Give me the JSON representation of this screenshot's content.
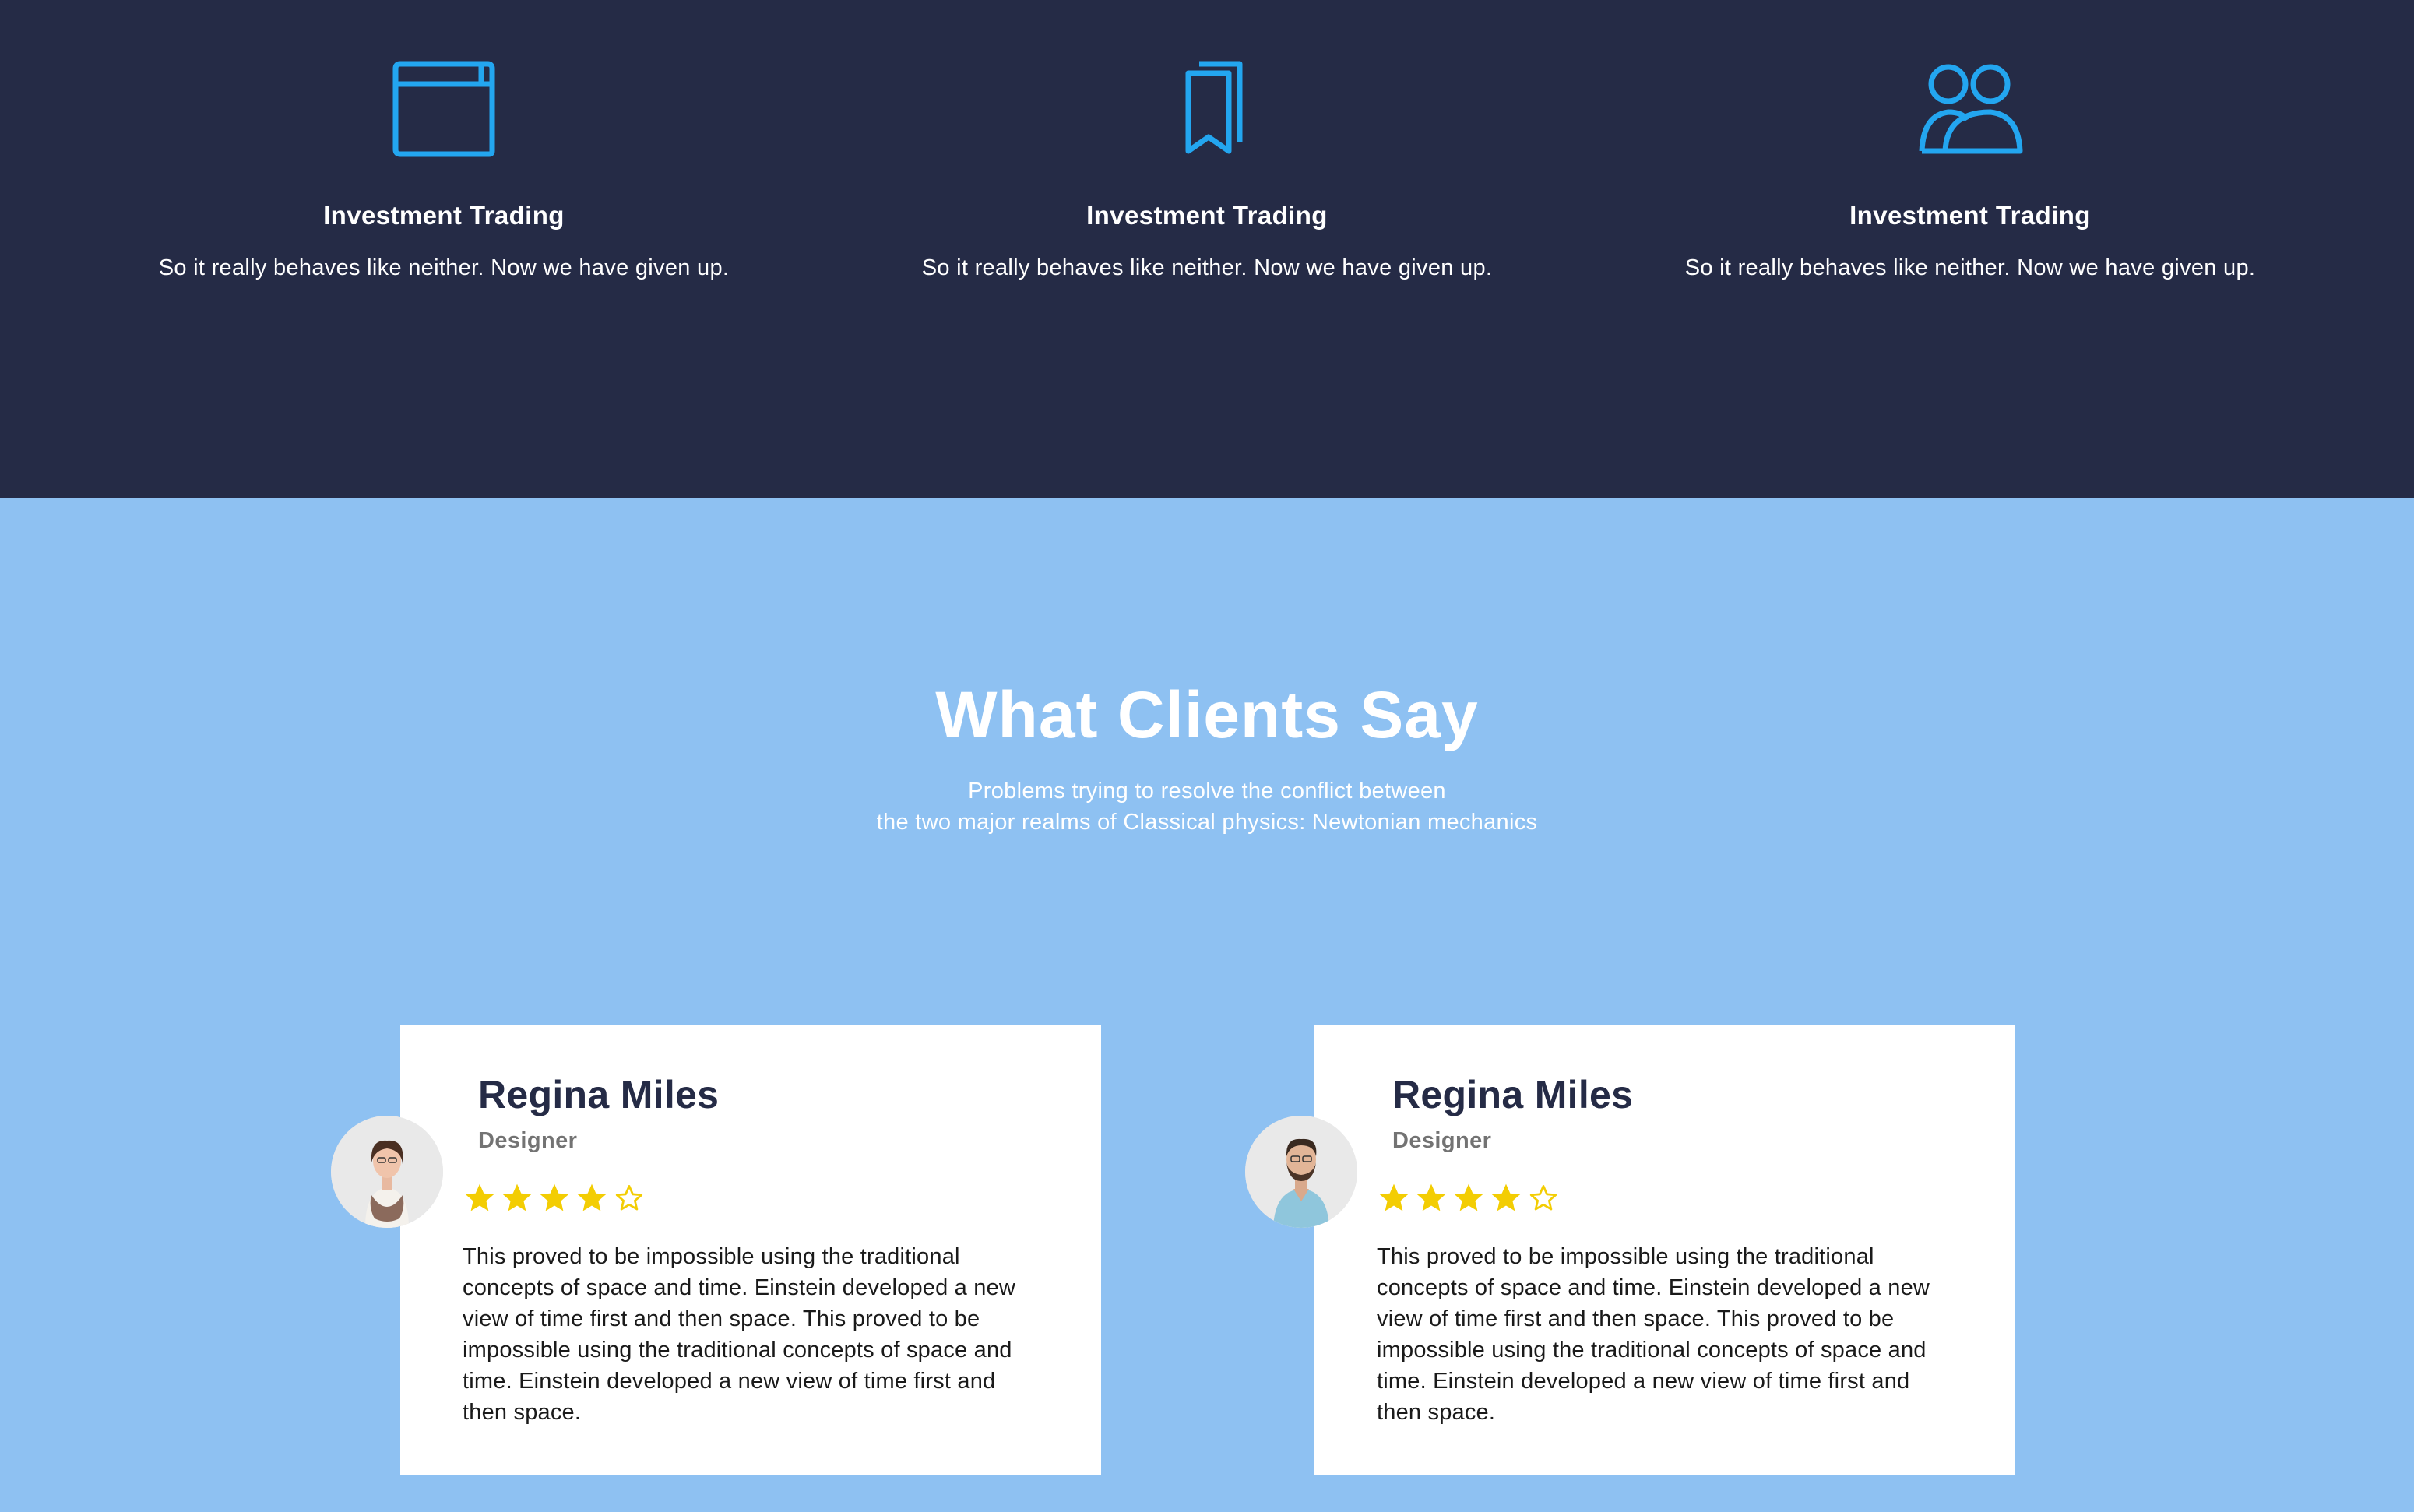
{
  "colors": {
    "dark_bg": "#252b46",
    "light_bg": "#8ec1f2",
    "icon_blue": "#23a6f0",
    "star_yellow": "#f3cd03",
    "name_color": "#252b46",
    "role_color": "#737373"
  },
  "features": [
    {
      "icon": "browser-window-icon",
      "title": "Investment Trading",
      "description": "So it really behaves like neither. Now we have given up."
    },
    {
      "icon": "bookmarks-icon",
      "title": "Investment Trading",
      "description": "So it really behaves like neither. Now we have given up."
    },
    {
      "icon": "users-icon",
      "title": "Investment Trading",
      "description": "So it really behaves like neither. Now we have given up."
    }
  ],
  "testimonials": {
    "title": "What Clients Say",
    "subtitle_line1": "Problems trying to resolve the conflict between",
    "subtitle_line2": "the two major realms of Classical physics: Newtonian mechanics",
    "items": [
      {
        "name": "Regina Miles",
        "role": "Designer",
        "rating": 4,
        "max_rating": 5,
        "avatar": "woman-avatar",
        "quote": "This proved to be impossible using the traditional concepts of space and time. Einstein developed a new view of time first and then space. This proved to be impossible using the traditional concepts of space and time. Einstein developed a new view of time first and then space."
      },
      {
        "name": "Regina Miles",
        "role": "Designer",
        "rating": 4,
        "max_rating": 5,
        "avatar": "man-avatar",
        "quote": "This proved to be impossible using the traditional concepts of space and time. Einstein developed a new view of time first and then space. This proved to be impossible using the traditional concepts of space and time. Einstein developed a new view of time first and then space."
      }
    ]
  }
}
